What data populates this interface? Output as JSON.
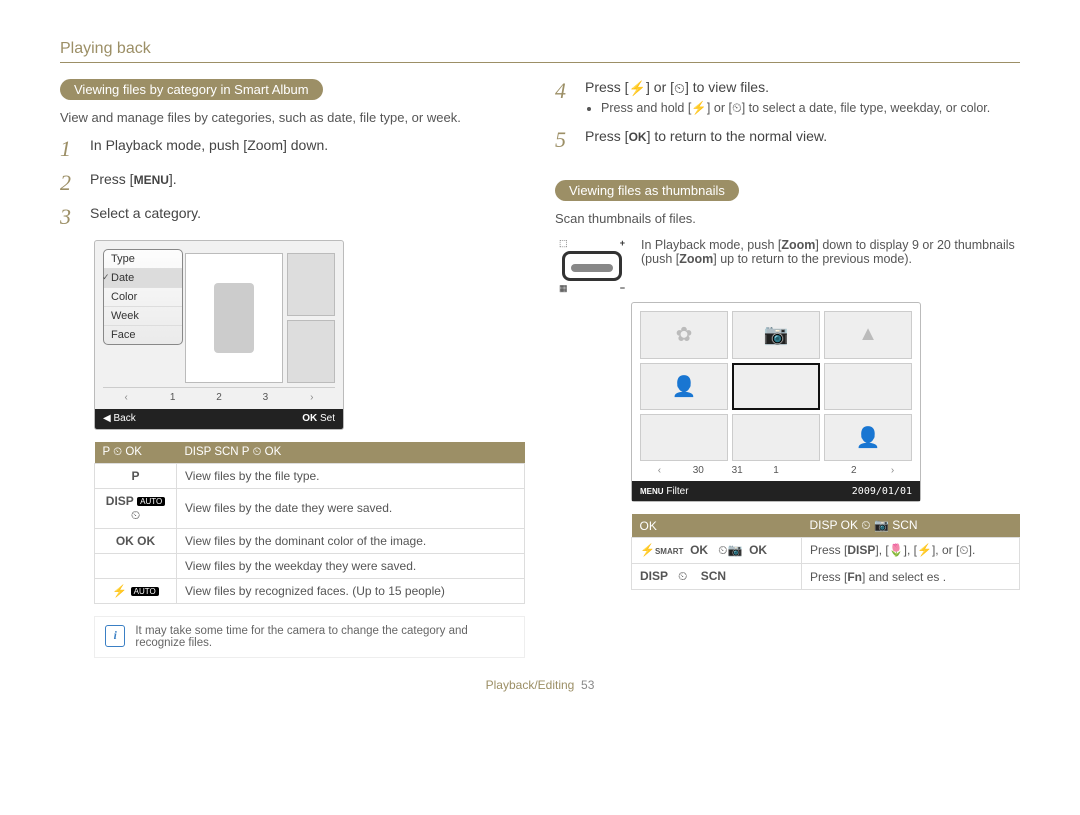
{
  "chapter": "Playing back",
  "left": {
    "pill": "Viewing files by category in Smart Album",
    "intro": "View and manage files by categories, such as date, file type, or week.",
    "steps": {
      "s1": "In Playback mode, push [Zoom] down.",
      "s2_pre": "Press [",
      "s2_token": "MENU",
      "s2_post": "].",
      "s3": "Select a category."
    },
    "cat_menu": [
      "Type",
      "Date",
      "Color",
      "Week",
      "Face"
    ],
    "cat_pager": [
      "1",
      "2",
      "3"
    ],
    "cat_footer_left_arrow": "◀",
    "cat_footer_left": "Back",
    "cat_footer_right_ok": "OK",
    "cat_footer_right": "Set",
    "table_header": {
      "left": "P  ⏲  OK",
      "right": "DISP   SCN       P ⏲  OK"
    },
    "table_rows": [
      {
        "glyph": "P",
        "desc": "View files by the file type."
      },
      {
        "glyph": "DISP AUTO ⏲",
        "desc": "View files by the date they were saved."
      },
      {
        "glyph": "OK   OK",
        "desc": "View files by the dominant color of the image."
      },
      {
        "glyph": "",
        "desc": "View files by the weekday they were saved."
      },
      {
        "glyph": "⚡ AUTO",
        "desc": "View files by recognized faces. (Up to 15 people)"
      }
    ],
    "note": "It may take some time for the camera to change the category and recognize files."
  },
  "right": {
    "step4_pre": "Press [",
    "step4_mid": "] or [",
    "step4_post": "] to view files.",
    "step4_sub_pre": "Press and hold [",
    "step4_sub_mid": "] or [",
    "step4_sub_post": "] to select a date, file type, weekday, or color.",
    "step5_pre": "Press [",
    "step5_token": "OK",
    "step5_post": "] to return to the normal view.",
    "pill2": "Viewing files as thumbnails",
    "intro2": "Scan thumbnails of files.",
    "zoom_labels": {
      "tl": "⬚",
      "tr": "+",
      "bl": "▦",
      "br": "−"
    },
    "zoom_text_a": "In Playback mode, push [",
    "zoom_text_b": "Zoom",
    "zoom_text_c": "] down to display 9 or 20 thumbnails (push [",
    "zoom_text_d": "Zoom",
    "zoom_text_e": "] up to return to the previous mode).",
    "thumb_pager": [
      "30",
      "31",
      "1",
      "",
      "2"
    ],
    "thumb_footer_left": "MENU",
    "thumb_footer_left2": "Filter",
    "thumb_footer_right": "2009/01/01",
    "table2_header": {
      "left": "OK",
      "right": "DISP OK   ⏲ 📷   SCN"
    },
    "table2_rows": [
      {
        "glyph": "⚡SMART  OK   ⏲📷  OK",
        "desc_pre": "Press [",
        "desc_token": "DISP",
        "desc_mid1": "], [",
        "desc_mid2": "], [",
        "desc_mid3": "], or [",
        "desc_post": "]."
      },
      {
        "glyph": "DISP   ⏲    SCN",
        "desc_pre": "Press [",
        "desc_token": "Fn",
        "desc_post": "] and select  es  ."
      }
    ]
  },
  "footer": {
    "section": "Playback/Editing",
    "page": "53"
  },
  "icons": {
    "flash": "⚡",
    "timer": "⏲"
  }
}
